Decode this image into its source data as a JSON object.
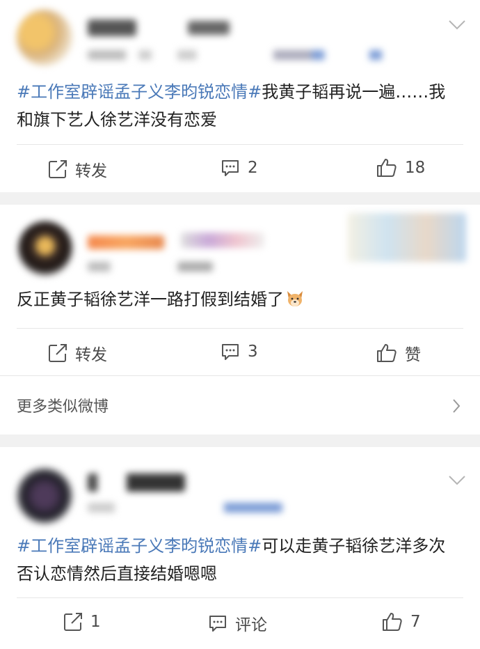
{
  "posts": [
    {
      "text_segments": [
        {
          "type": "tag",
          "text": "#工作室辟谣孟子义李昀锐恋情#"
        },
        {
          "type": "plain",
          "text": "我黄子韬再说一遍……我和旗下艺人徐艺洋没有恋爱"
        }
      ],
      "actions": {
        "repost": "转发",
        "comment": "2",
        "like": "18"
      }
    },
    {
      "text_segments": [
        {
          "type": "plain",
          "text": "反正黄子韬徐艺洋一路打假到结婚了"
        }
      ],
      "emoji": "dog-face-emoji",
      "actions": {
        "repost": "转发",
        "comment": "3",
        "like": "赞"
      }
    },
    {
      "text_segments": [
        {
          "type": "tag",
          "text": "#工作室辟谣孟子义李昀锐恋情#"
        },
        {
          "type": "plain",
          "text": "可以走黄子韬徐艺洋多次否认恋情然后直接结婚嗯嗯"
        }
      ],
      "actions": {
        "repost": "1",
        "comment": "评论",
        "like": "7"
      }
    }
  ],
  "more_similar": {
    "label": "更多类似微博"
  },
  "colors": {
    "tag": "#4a79b8",
    "background": "#f1f1f1",
    "card": "#ffffff"
  }
}
